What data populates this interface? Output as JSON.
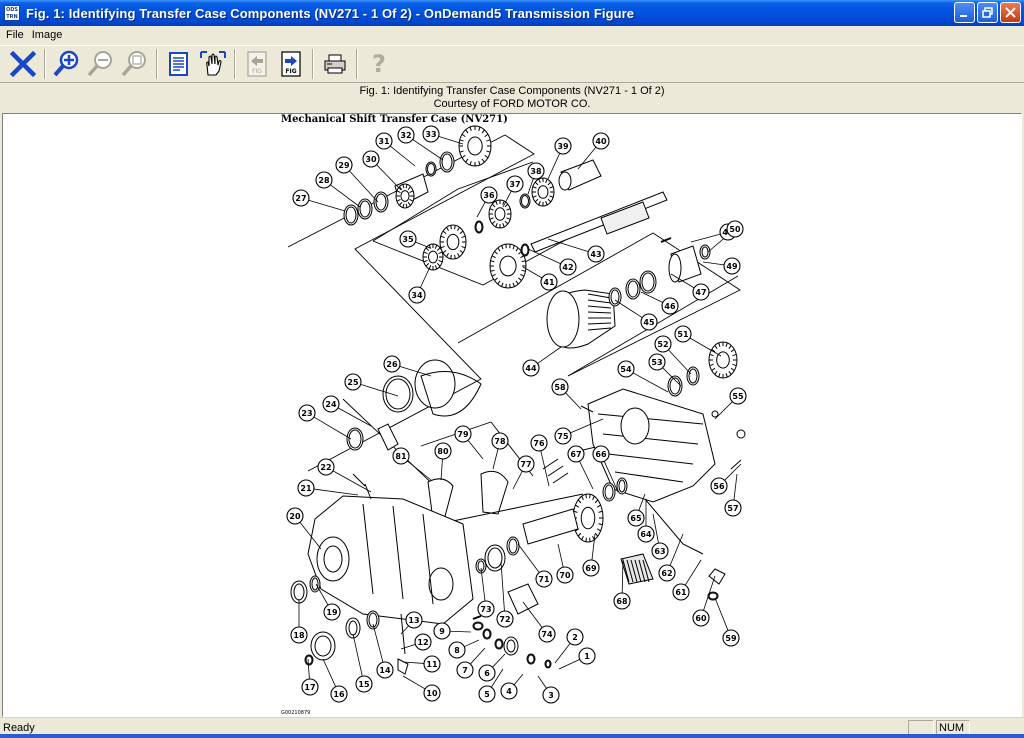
{
  "window": {
    "title": "Fig. 1: Identifying Transfer Case Components (NV271 - 1 Of 2) - OnDemand5 Transmission Figure",
    "app_icon_text": "ODS TRN"
  },
  "menu": {
    "items": [
      {
        "label": "File"
      },
      {
        "label": "Image"
      }
    ]
  },
  "toolbar": {
    "buttons": [
      {
        "icon": "close-x-icon",
        "enabled": true
      },
      {
        "icon": "zoom-in-icon",
        "enabled": true
      },
      {
        "icon": "zoom-out-icon",
        "enabled": false
      },
      {
        "icon": "zoom-fit-icon",
        "enabled": false
      },
      {
        "icon": "document-icon",
        "enabled": true
      },
      {
        "icon": "pan-hand-icon",
        "enabled": true
      },
      {
        "icon": "previous-figure-icon",
        "enabled": false,
        "label": "FIG"
      },
      {
        "icon": "next-figure-icon",
        "enabled": true,
        "label": "FIG"
      },
      {
        "icon": "print-icon",
        "enabled": true
      },
      {
        "icon": "help-icon",
        "enabled": false
      }
    ]
  },
  "caption": {
    "line1": "Fig. 1: Identifying Transfer Case Components (NV271 - 1 Of 2)",
    "line2": "Courtesy of FORD MOTOR CO."
  },
  "figure": {
    "heading": "Mechanical Shift Transfer Case (NV271)",
    "code": "G00210879",
    "callouts": [
      "1",
      "2",
      "3",
      "4",
      "5",
      "6",
      "7",
      "8",
      "9",
      "10",
      "11",
      "12",
      "13",
      "14",
      "15",
      "16",
      "17",
      "18",
      "19",
      "20",
      "21",
      "22",
      "23",
      "24",
      "25",
      "26",
      "27",
      "28",
      "29",
      "30",
      "31",
      "32",
      "33",
      "34",
      "35",
      "36",
      "37",
      "38",
      "39",
      "40",
      "41",
      "42",
      "43",
      "44",
      "45",
      "46",
      "47",
      "48",
      "49",
      "50",
      "51",
      "52",
      "53",
      "54",
      "55",
      "56",
      "57",
      "58",
      "59",
      "60",
      "61",
      "62",
      "63",
      "64",
      "65",
      "66",
      "67",
      "68",
      "69",
      "70",
      "71",
      "72",
      "73",
      "74",
      "75",
      "76",
      "77",
      "78",
      "79",
      "80",
      "81"
    ]
  },
  "status": {
    "text": "Ready",
    "panel_num": "NUM"
  },
  "colors": {
    "titlebar": "#0153e0",
    "chrome": "#ece9d8",
    "accent_blue": "#1a46c8"
  }
}
